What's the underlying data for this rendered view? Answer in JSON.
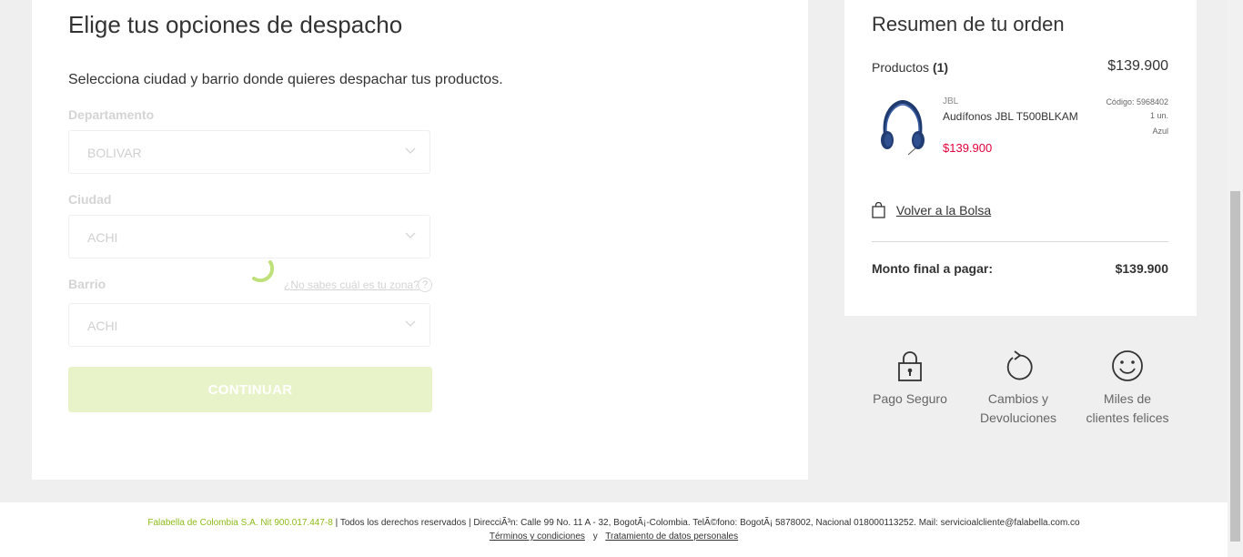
{
  "shipping": {
    "title": "Elige tus opciones de despacho",
    "subtitle": "Selecciona ciudad y barrio donde quieres despachar tus productos.",
    "department": {
      "label": "Departamento",
      "value": "BOLIVAR"
    },
    "city": {
      "label": "Ciudad",
      "value": "ACHI"
    },
    "neighborhood": {
      "label": "Barrio",
      "value": "ACHI"
    },
    "zone_help": "¿No sabes cuál es tu zona?",
    "help_glyph": "?",
    "continue_label": "CONTINUAR",
    "continue_color": "#e8f3ca"
  },
  "summary": {
    "title": "Resumen de tu orden",
    "products_label": "Productos",
    "products_count": "(1)",
    "products_total": "$139.900",
    "item": {
      "brand": "JBL",
      "name": "Audífonos JBL T500BLKAM",
      "price": "$139.900",
      "code": "Código: 5968402",
      "quantity": "1 un.",
      "color": "Azul",
      "image_icon": "headphones-image"
    },
    "back_label": "Volver a la Bolsa",
    "final_label": "Monto final a pagar:",
    "final_amount": "$139.900",
    "price_color": "#e3003b"
  },
  "badges": [
    {
      "label": "Pago Seguro",
      "icon": "lock-icon"
    },
    {
      "label_line1": "Cambios y",
      "label_line2": "Devoluciones",
      "icon": "refresh-icon"
    },
    {
      "label_line1": "Miles de",
      "label_line2": "clientes felices",
      "icon": "smiley-icon"
    }
  ],
  "footer": {
    "company": "Falabella de Colombia S.A. Nit 900.017.447-8",
    "sep1": " | ",
    "rights": "Todos los derechos reservados",
    "sep2": " | ",
    "address": "DirecciÃ³n: Calle 99 No. 11 A - 32, BogotÃ¡-Colombia. TelÃ©fono: BogotÃ¡ 5878002, Nacional 018000113252. Mail: servicioalcliente@falabella.com.co",
    "terms": "Términos y condiciones",
    "and": "y",
    "privacy": "Tratamiento de datos personales",
    "company_color": "#8dbb1a"
  }
}
